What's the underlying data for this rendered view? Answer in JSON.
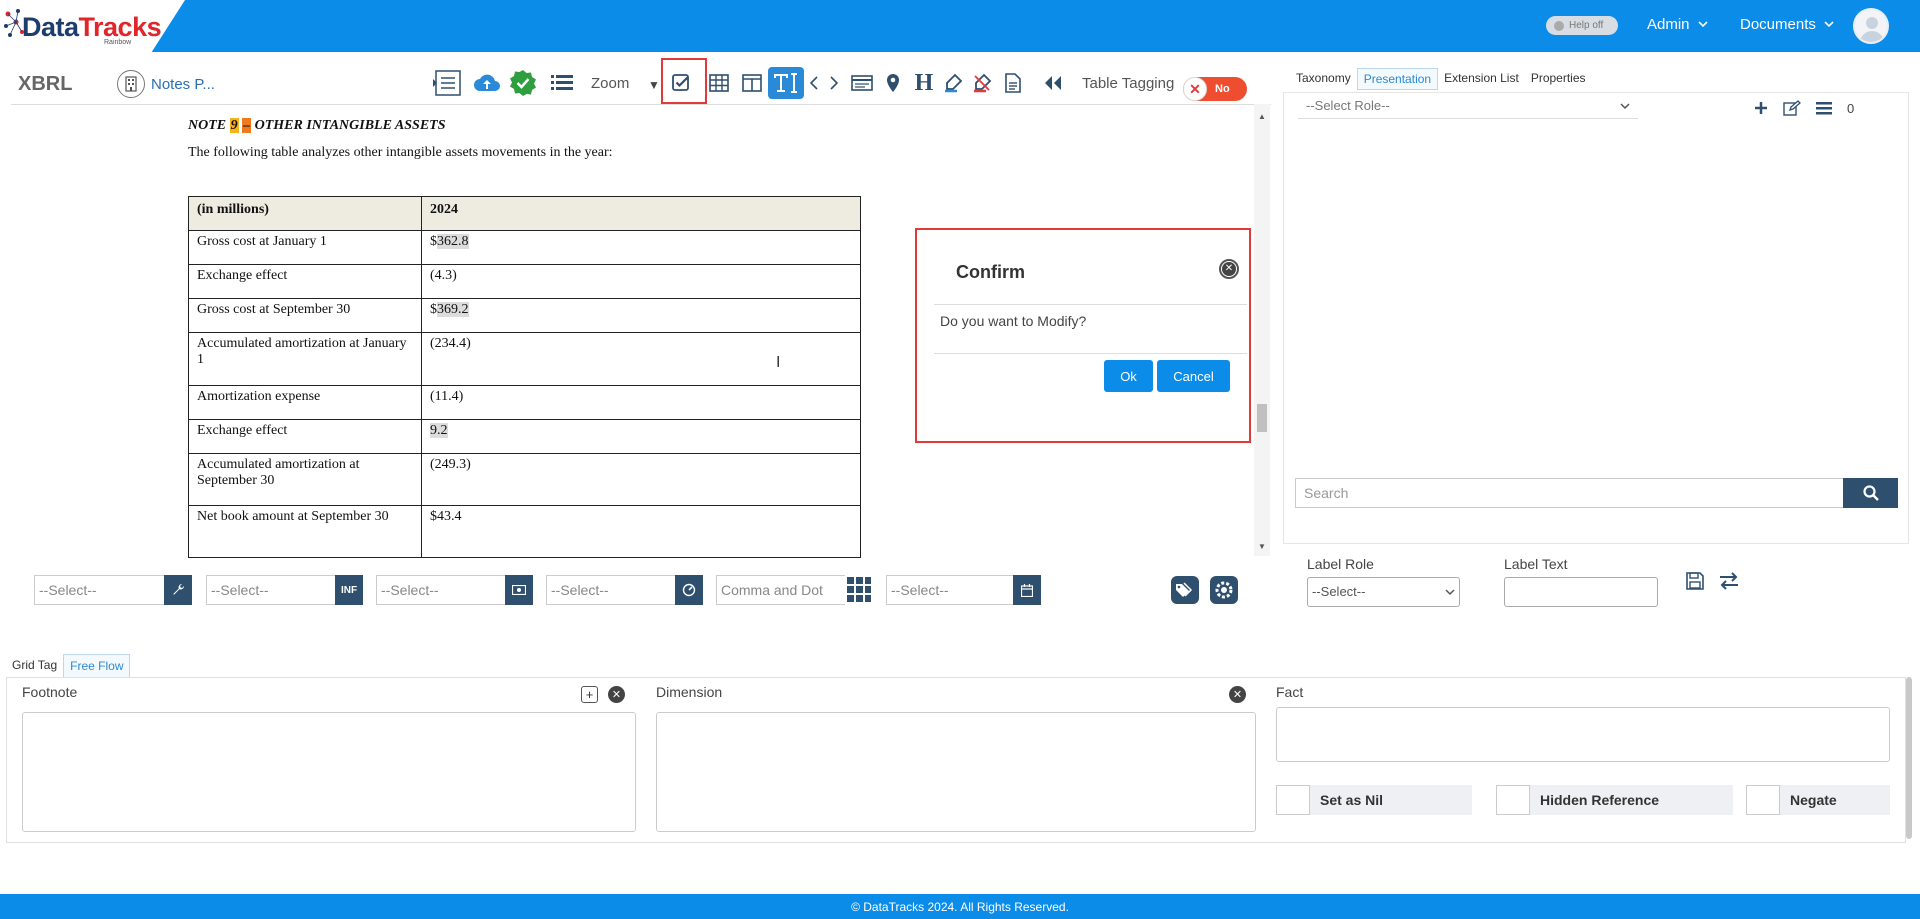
{
  "brand": {
    "name_a": "Data",
    "name_b": "Tracks",
    "sub": "Rainbow"
  },
  "header": {
    "help_toggle": "Help off",
    "admin": "Admin",
    "documents": "Documents"
  },
  "toolbar": {
    "xbrl": "XBRL",
    "notes": "Notes P...",
    "zoom": "Zoom",
    "table_tagging": "Table Tagging",
    "toggle_state": "No"
  },
  "document": {
    "note_prefix": "NOTE ",
    "note_num": "9",
    "note_dash": "–",
    "note_rest": " OTHER INTANGIBLE ASSETS",
    "description": "The following table analyzes other intangible assets movements in the year:",
    "table": {
      "headers": [
        "(in millions)",
        "2024"
      ],
      "rows": [
        {
          "label": "Gross cost at January 1",
          "prefix": "$",
          "value": "362.8",
          "highlight": true
        },
        {
          "label": "Exchange effect",
          "prefix": "",
          "value": "(4.3)",
          "highlight": false
        },
        {
          "label": "Gross cost at September 30",
          "prefix": "$",
          "value": "369.2",
          "highlight": true
        },
        {
          "label": "Accumulated amortization at January 1",
          "prefix": "",
          "value": "(234.4)",
          "highlight": false
        },
        {
          "label": "Amortization expense",
          "prefix": "",
          "value": "(11.4)",
          "highlight": false
        },
        {
          "label": "Exchange effect",
          "prefix": "",
          "value": "9.2",
          "highlight": true
        },
        {
          "label": "Accumulated amortization at September 30",
          "prefix": "",
          "value": "(249.3)",
          "highlight": false
        },
        {
          "label": "Net book amount at September 30",
          "prefix": "",
          "value": "$43.4",
          "highlight": false
        }
      ]
    }
  },
  "dialog": {
    "title": "Confirm",
    "message": "Do you want to Modify?",
    "ok": "Ok",
    "cancel": "Cancel"
  },
  "right_panel": {
    "tabs": [
      "Taxonomy",
      "Presentation",
      "Extension List",
      "Properties"
    ],
    "active_tab": "Presentation",
    "role_placeholder": "--Select Role--",
    "count": "0",
    "search_placeholder": "Search"
  },
  "selectors": {
    "s1": "--Select--",
    "s1_btn": "wrench-icon",
    "s2": "--Select--",
    "s2_btn": "INF",
    "s3": "--Select--",
    "s4": "--Select--",
    "s5": "Comma and Dot",
    "s6": "--Select--"
  },
  "label_panel": {
    "label_role": "Label Role",
    "label_text": "Label Text",
    "role_select": "--Select--"
  },
  "bottom": {
    "tabs": [
      "Grid Tag",
      "Free Flow"
    ],
    "active_tab": "Free Flow",
    "footnote": "Footnote",
    "dimension": "Dimension",
    "fact": "Fact",
    "set_as_nil": "Set as Nil",
    "hidden_reference": "Hidden Reference",
    "negate": "Negate"
  },
  "footer": {
    "text": "© DataTracks 2024. All Rights Reserved."
  },
  "colors": {
    "brand_blue": "#0b8ce9",
    "dark_navy": "#2f4f6f",
    "alert_red": "#e03a3a"
  }
}
